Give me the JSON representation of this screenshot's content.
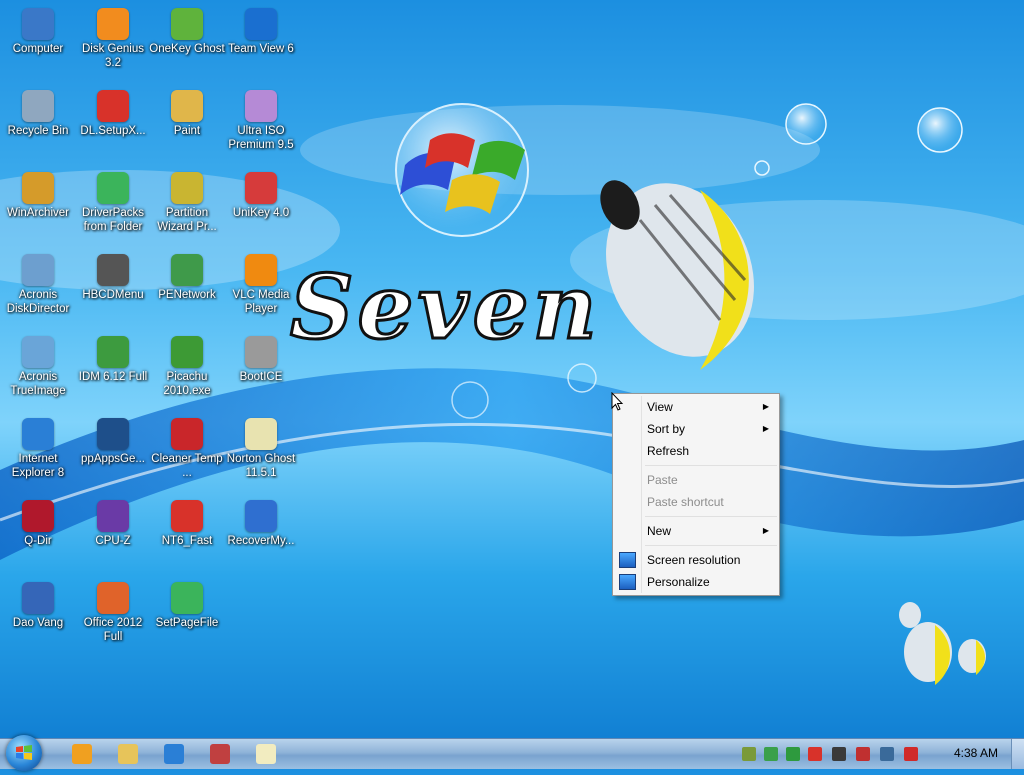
{
  "wallpaper": {
    "text": "Seven"
  },
  "desktop_icons": [
    {
      "label": "Computer",
      "icon": "computer-icon",
      "color": "#3a78c8"
    },
    {
      "label": "Disk Genius 3.2",
      "icon": "disk-genius-icon",
      "color": "#f28c1e"
    },
    {
      "label": "OneKey Ghost",
      "icon": "onekey-ghost-icon",
      "color": "#5fb33c"
    },
    {
      "label": "Team View 6",
      "icon": "teamviewer-icon",
      "color": "#1a6fd0"
    },
    {
      "label": "Recycle Bin",
      "icon": "recycle-bin-icon",
      "color": "#8fa7bf"
    },
    {
      "label": "DL.SetupX...",
      "icon": "setup-star-icon",
      "color": "#d8322a"
    },
    {
      "label": "Paint",
      "icon": "paint-icon",
      "color": "#e0b64a"
    },
    {
      "label": "Ultra ISO Premium 9.5",
      "icon": "ultraiso-disc-icon",
      "color": "#b58ad6"
    },
    {
      "label": "WinArchiver",
      "icon": "winarchiver-icon",
      "color": "#d59b2a"
    },
    {
      "label": "DriverPacks from Folder",
      "icon": "driverpacks-icon",
      "color": "#3bb45b"
    },
    {
      "label": "Partition Wizard Pr...",
      "icon": "partition-wizard-icon",
      "color": "#c9b531"
    },
    {
      "label": "UniKey 4.0",
      "icon": "unikey-icon",
      "color": "#d63b3b"
    },
    {
      "label": "Acronis DiskDirector",
      "icon": "acronis-disk-icon",
      "color": "#6d9fcf"
    },
    {
      "label": "HBCDMenu",
      "icon": "hbcd-tools-icon",
      "color": "#555555"
    },
    {
      "label": "PENetwork",
      "icon": "penetwork-icon",
      "color": "#3f9a4a"
    },
    {
      "label": "VLC Media Player",
      "icon": "vlc-cone-icon",
      "color": "#f08a10"
    },
    {
      "label": "Acronis TrueImage",
      "icon": "acronis-trueimage-icon",
      "color": "#6aa5d8"
    },
    {
      "label": "IDM 6.12 Full",
      "icon": "idm-icon",
      "color": "#3d9b3f"
    },
    {
      "label": "Picachu 2010.exe",
      "icon": "picachu-icon",
      "color": "#3d9a35"
    },
    {
      "label": "BootICE",
      "icon": "bootice-icon",
      "color": "#9a9a9a"
    },
    {
      "label": "Internet Explorer 8",
      "icon": "internet-explorer-icon",
      "color": "#2a7fd6"
    },
    {
      "label": "ppAppsGe...",
      "icon": "ppapps-icon",
      "color": "#1e4f8a"
    },
    {
      "label": "Cleaner Temp ...",
      "icon": "ccleaner-icon",
      "color": "#c9262a"
    },
    {
      "label": "Norton Ghost 11.5.1",
      "icon": "norton-ghost-icon",
      "color": "#e8e3b0"
    },
    {
      "label": "Q-Dir",
      "icon": "q-dir-icon",
      "color": "#b0182c"
    },
    {
      "label": "CPU-Z",
      "icon": "cpu-z-icon",
      "color": "#6a3aa6"
    },
    {
      "label": "NT6_Fast",
      "icon": "nt6-fast-icon",
      "color": "#d8322a"
    },
    {
      "label": "RecoverMy...",
      "icon": "recovermy-icon",
      "color": "#2f6fd0"
    },
    {
      "label": "Dao Vang",
      "icon": "dao-vang-icon",
      "color": "#3566b8"
    },
    {
      "label": "Office 2012 Full",
      "icon": "office-icon",
      "color": "#e0632a"
    },
    {
      "label": "SetPageFile",
      "icon": "setpagefile-icon",
      "color": "#3bb45b"
    }
  ],
  "context_menu": {
    "view": "View",
    "sort_by": "Sort by",
    "refresh": "Refresh",
    "paste": "Paste",
    "paste_shortcut": "Paste shortcut",
    "new": "New",
    "screen_resolution": "Screen resolution",
    "personalize": "Personalize"
  },
  "taskbar": {
    "pinned": [
      {
        "icon": "media-player-icon",
        "color": "#f0a020"
      },
      {
        "icon": "folder-icon",
        "color": "#e7c45a"
      },
      {
        "icon": "internet-explorer-icon",
        "color": "#2a7fd6"
      },
      {
        "icon": "network-tool-icon",
        "color": "#c04040"
      },
      {
        "icon": "ghost-icon",
        "color": "#f2ecc0"
      }
    ],
    "tray": [
      {
        "icon": "tray-tool-icon",
        "color": "#7a9a3a"
      },
      {
        "icon": "shield-check-icon",
        "color": "#3aa04a"
      },
      {
        "icon": "play-circle-icon",
        "color": "#2e9a3e"
      },
      {
        "icon": "star-badge-icon",
        "color": "#d8322a"
      },
      {
        "icon": "eject-icon",
        "color": "#3a3a3a"
      },
      {
        "icon": "flag-icon",
        "color": "#c03030"
      },
      {
        "icon": "network-icon",
        "color": "#3a6a9a"
      },
      {
        "icon": "volume-muted-icon",
        "color": "#d02a2a"
      }
    ],
    "clock": "4:38 AM"
  }
}
